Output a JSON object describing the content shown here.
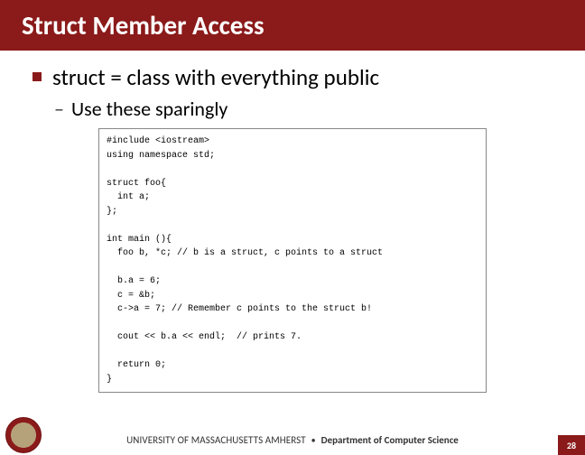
{
  "header": {
    "title": "Struct Member Access"
  },
  "bullets": {
    "main": "struct = class with everything public",
    "sub": "Use these sparingly"
  },
  "code": {
    "lines": [
      "#include <iostream>",
      "using namespace std;",
      "",
      "struct foo{",
      "  int a;",
      "};",
      "",
      "int main (){",
      "  foo b, *c; // b is a struct, c points to a struct",
      "",
      "  b.a = 6;",
      "  c = &b;",
      "  c->a = 7; // Remember c points to the struct b!",
      "",
      "  cout << b.a << endl;  // prints 7.",
      "",
      "  return 0;",
      "}"
    ]
  },
  "footer": {
    "university": "UNIVERSITY OF MASSACHUSETTS AMHERST",
    "separator": "•",
    "department": "Department of Computer Science",
    "page": "28"
  }
}
